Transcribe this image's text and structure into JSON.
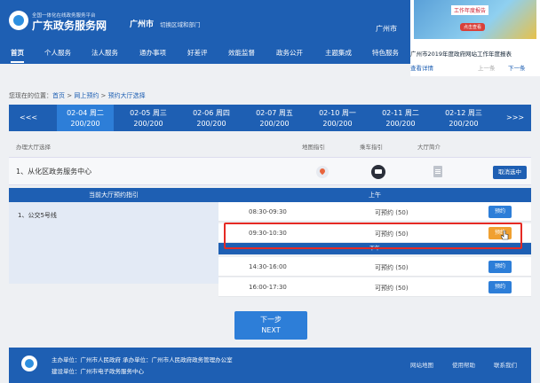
{
  "header": {
    "logo_sub": "全国一体化在线政务服务平台",
    "logo_title": "广东政务服务网",
    "city": "广州市",
    "switch_label": "切换区域和部门",
    "city_repeat": "广州市"
  },
  "promo": {
    "image_text": "工作年度报告",
    "image_button": "点击查看",
    "title": "广州市2019年度政府网站工作年度报表",
    "detail_link": "查看详情",
    "prev": "上一条",
    "next": "下一条"
  },
  "nav": {
    "items": [
      {
        "label": "首页",
        "active": true
      },
      {
        "label": "个人服务"
      },
      {
        "label": "法人服务"
      },
      {
        "label": "通办事项"
      },
      {
        "label": "好差评"
      },
      {
        "label": "效能监督"
      },
      {
        "label": "政务公开"
      },
      {
        "label": "主题集成"
      },
      {
        "label": "特色服务"
      }
    ]
  },
  "breadcrumb": {
    "prefix": "您现在的位置：",
    "home": "首页",
    "sep1": " > ",
    "online": "网上预约",
    "sep2": " > ",
    "current": "预约大厅选择"
  },
  "datebar": {
    "prev_arrow": "<<<",
    "next_arrow": ">>>",
    "dates": [
      {
        "day": "02-04 周二",
        "count": "200/200",
        "active": true
      },
      {
        "day": "02-05 周三",
        "count": "200/200"
      },
      {
        "day": "02-06 周四",
        "count": "200/200"
      },
      {
        "day": "02-07 周五",
        "count": "200/200"
      },
      {
        "day": "02-10 周一",
        "count": "200/200"
      },
      {
        "day": "02-11 周二",
        "count": "200/200"
      },
      {
        "day": "02-12 周三",
        "count": "200/200"
      }
    ]
  },
  "list": {
    "col_hall": "办理大厅选择",
    "col_map": "地图指引",
    "col_bus": "乘车指引",
    "col_intro": "大厅简介",
    "hall_name": "1、从化区政务服务中心",
    "cancel_label": "取消选中"
  },
  "guide": {
    "title": "当前大厅预约指引",
    "line1": "1、公交5号线"
  },
  "schedule": {
    "am_title": "上午",
    "pm_title": "下午",
    "book_label": "预约",
    "slots": [
      {
        "time": "08:30-09:30",
        "avail": "可预约 (50)"
      },
      {
        "time": "09:30-10:30",
        "avail": "可预约 (50)"
      },
      {
        "time": "14:30-16:00",
        "avail": "可预约 (50)"
      },
      {
        "time": "16:00-17:30",
        "avail": "可预约 (50)"
      }
    ]
  },
  "next_button": {
    "line1": "下一步",
    "line2": "NEXT"
  },
  "footer": {
    "line1": "主办单位：广州市人民政府 承办单位：广州市人民政府政务管理办公室",
    "line2": "建设单位：广州市电子政务服务中心",
    "links": [
      "网站地图",
      "使用帮助",
      "联系我们"
    ]
  },
  "colors": {
    "primary": "#1e5fb3",
    "button": "#2d7ed8",
    "highlight": "#e52a24",
    "cursor_button": "#f0a030"
  }
}
